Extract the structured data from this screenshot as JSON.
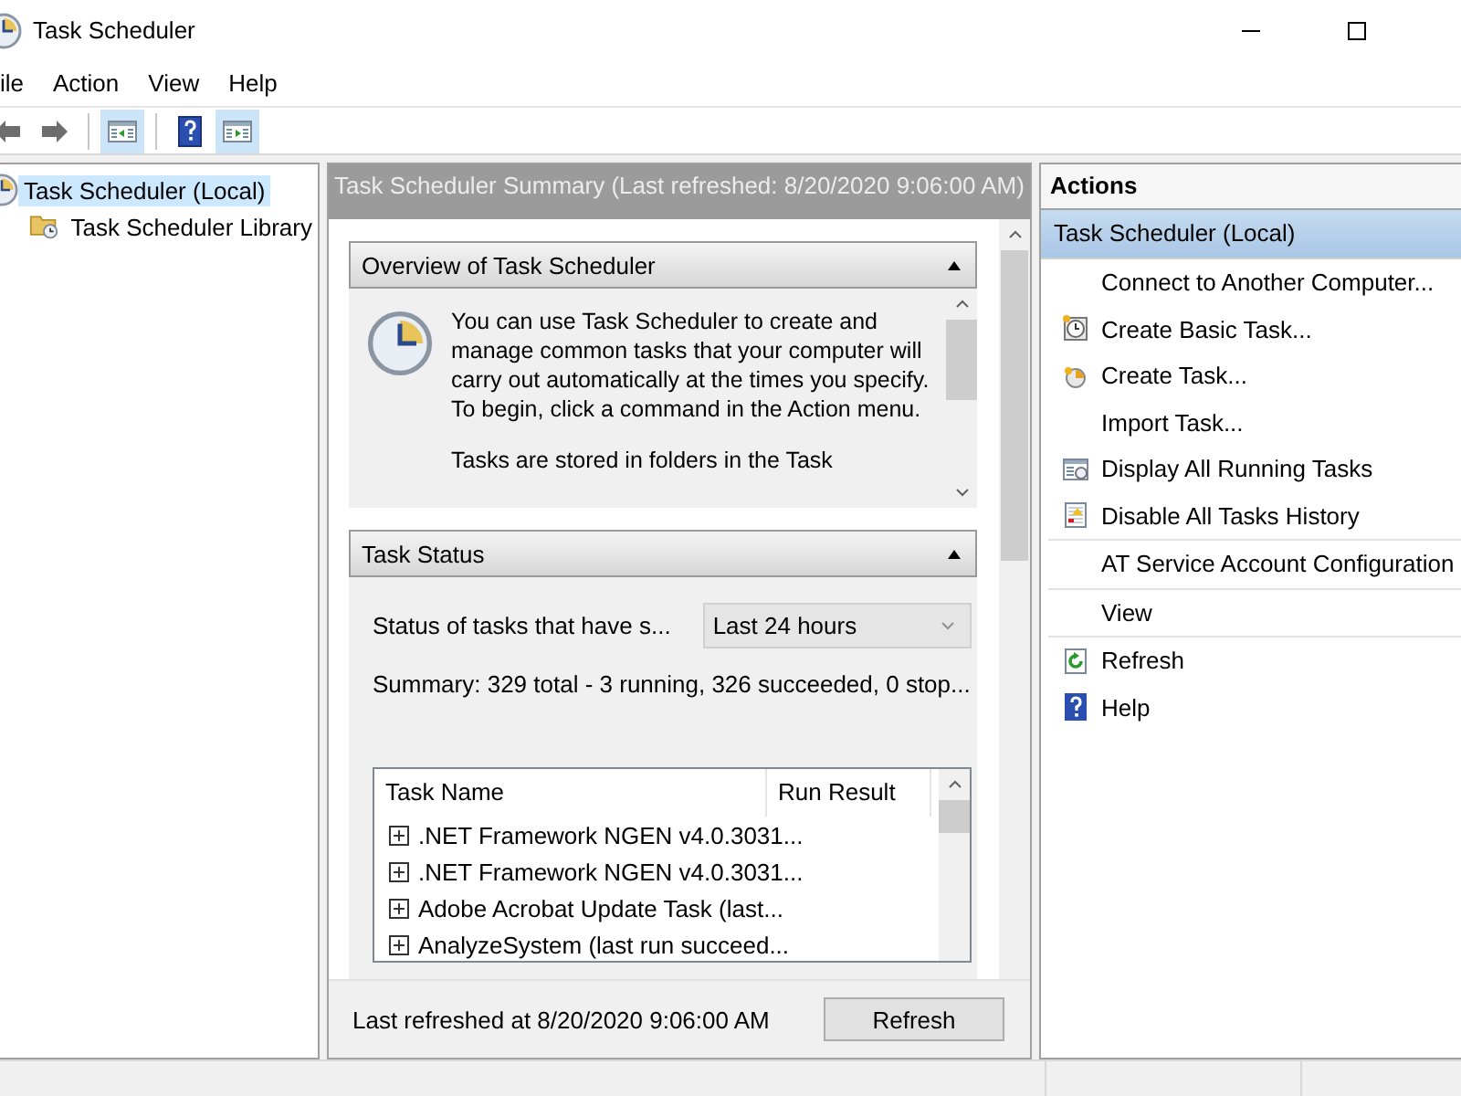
{
  "window": {
    "title": "Task Scheduler",
    "controls": [
      {
        "kind": "minimize"
      },
      {
        "kind": "maximize"
      }
    ]
  },
  "menu": [
    {
      "label": "ile"
    },
    {
      "label": "Action"
    },
    {
      "label": "View"
    },
    {
      "label": "Help"
    }
  ],
  "toolbar": [
    {
      "kind": "back",
      "on": false
    },
    {
      "kind": "forward",
      "on": false
    },
    {
      "kind": "separator"
    },
    {
      "kind": "pane-left",
      "on": true
    },
    {
      "kind": "separator"
    },
    {
      "kind": "help",
      "on": false
    },
    {
      "kind": "pane-right",
      "on": true
    }
  ],
  "tree": [
    {
      "label": "Task Scheduler (Local)",
      "kind": "clock",
      "selected": true,
      "children": [
        {
          "label": "Task Scheduler Library",
          "kind": "folder",
          "selected": false
        }
      ]
    }
  ],
  "summary": {
    "header": "Task Scheduler Summary (Last refreshed: 8/20/2020 9:06:00 AM)",
    "overview": {
      "title": "Overview of Task Scheduler",
      "expanded": true,
      "paragraphs": [
        "You can use Task Scheduler to create and manage common tasks that your computer will carry out automatically at the times you specify. To begin, click a command in the Action menu.",
        "Tasks are stored in folders in the Task"
      ]
    },
    "status": {
      "title": "Task Status",
      "expanded": true,
      "filter_label": "Status of tasks that have s...",
      "filter_value": "Last 24 hours",
      "summary": "Summary: 329 total - 3 running, 326 succeeded, 0 stop...",
      "columns": [
        "Task Name",
        "Run Result"
      ],
      "rows": [
        {
          "name": ".NET Framework NGEN v4.0.3031...",
          "expanded": false
        },
        {
          "name": ".NET Framework NGEN v4.0.3031...",
          "expanded": false
        },
        {
          "name": "Adobe Acrobat Update Task (last...",
          "expanded": false
        },
        {
          "name": "AnalyzeSystem (last run succeed...",
          "expanded": false
        }
      ]
    },
    "footer": {
      "text": "Last refreshed at 8/20/2020 9:06:00 AM",
      "button": "Refresh"
    }
  },
  "actions": {
    "title": "Actions",
    "group": {
      "label": "Task Scheduler (Local)",
      "selected": true
    },
    "items": [
      {
        "label": "Connect to Another Computer...",
        "kind": "plain",
        "separator_after": false
      },
      {
        "label": "Create Basic Task...",
        "kind": "basic-task",
        "separator_after": false
      },
      {
        "label": "Create Task...",
        "kind": "task",
        "separator_after": false
      },
      {
        "label": "Import Task...",
        "kind": "plain",
        "separator_after": false
      },
      {
        "label": "Display All Running Tasks",
        "kind": "running",
        "separator_after": false
      },
      {
        "label": "Disable All Tasks History",
        "kind": "history",
        "separator_after": true
      },
      {
        "label": "AT Service Account Configuration",
        "kind": "plain",
        "separator_after": true
      },
      {
        "label": "View",
        "kind": "plain",
        "separator_after": true
      },
      {
        "label": "Refresh",
        "kind": "refresh",
        "separator_after": false
      },
      {
        "label": "Help",
        "kind": "help",
        "separator_after": false
      }
    ]
  }
}
